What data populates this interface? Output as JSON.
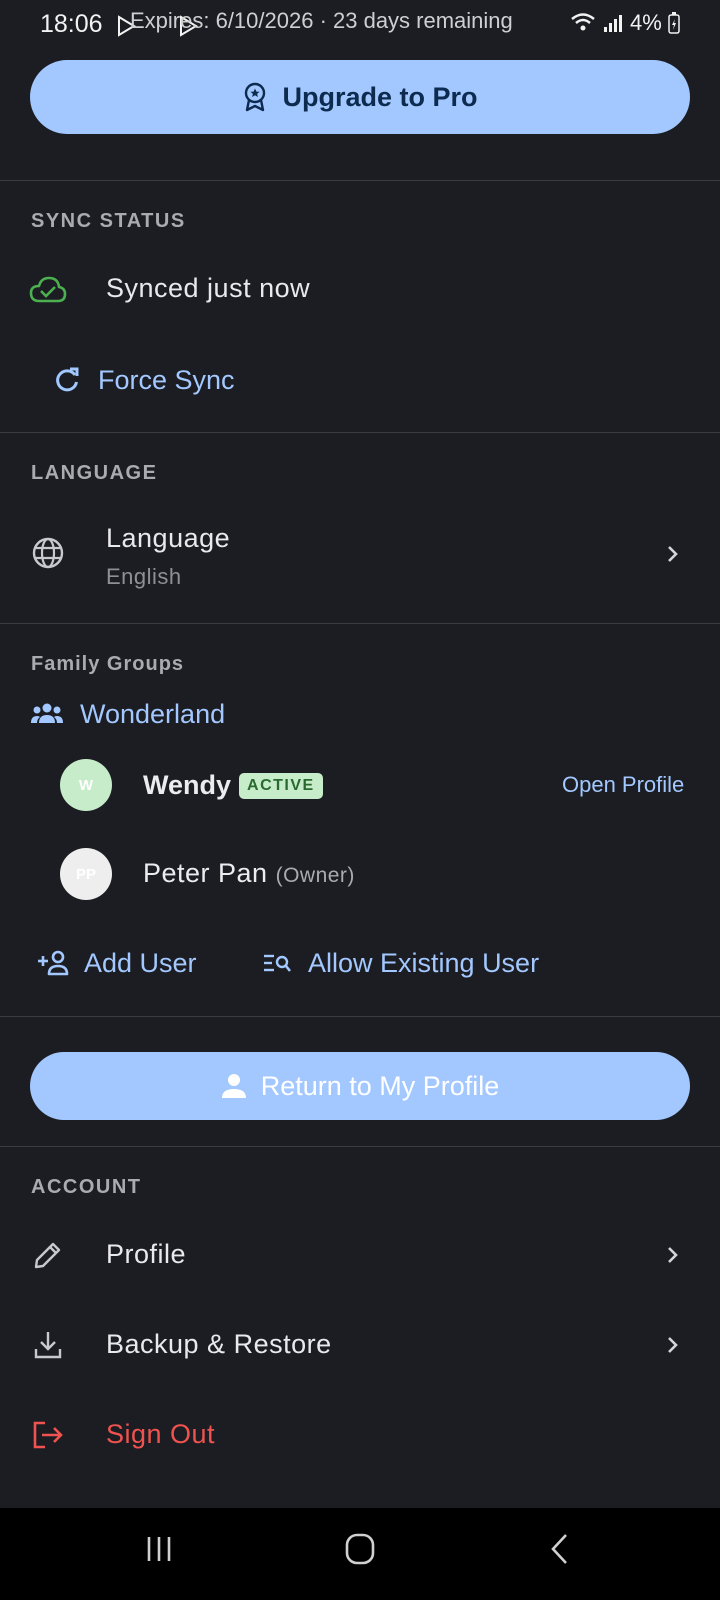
{
  "status_bar": {
    "time": "18:06",
    "expiry": "Expires: 6/10/2026 · 23 days remaining",
    "battery": "4%"
  },
  "upgrade": {
    "label": "Upgrade to Pro"
  },
  "sync": {
    "section_title": "SYNC STATUS",
    "status_text": "Synced just now",
    "force_label": "Force Sync"
  },
  "language": {
    "section_title": "LANGUAGE",
    "label": "Language",
    "value": "English"
  },
  "family": {
    "section_title": "Family Groups",
    "group_name": "Wonderland",
    "members": [
      {
        "initials": "W",
        "name": "Wendy",
        "badge": "ACTIVE",
        "action": "Open Profile"
      },
      {
        "initials": "PP",
        "name": "Peter Pan",
        "role": "(Owner)"
      }
    ],
    "add_user": "Add User",
    "allow_existing": "Allow Existing User"
  },
  "return_profile": {
    "label": "Return to My Profile"
  },
  "account": {
    "section_title": "ACCOUNT",
    "items": [
      {
        "label": "Profile"
      },
      {
        "label": "Backup & Restore"
      },
      {
        "label": "Sign Out"
      }
    ]
  },
  "colors": {
    "background": "#1b1d22",
    "accent": "#a3c8ff",
    "success": "#4caf50",
    "danger": "#ef5350"
  }
}
